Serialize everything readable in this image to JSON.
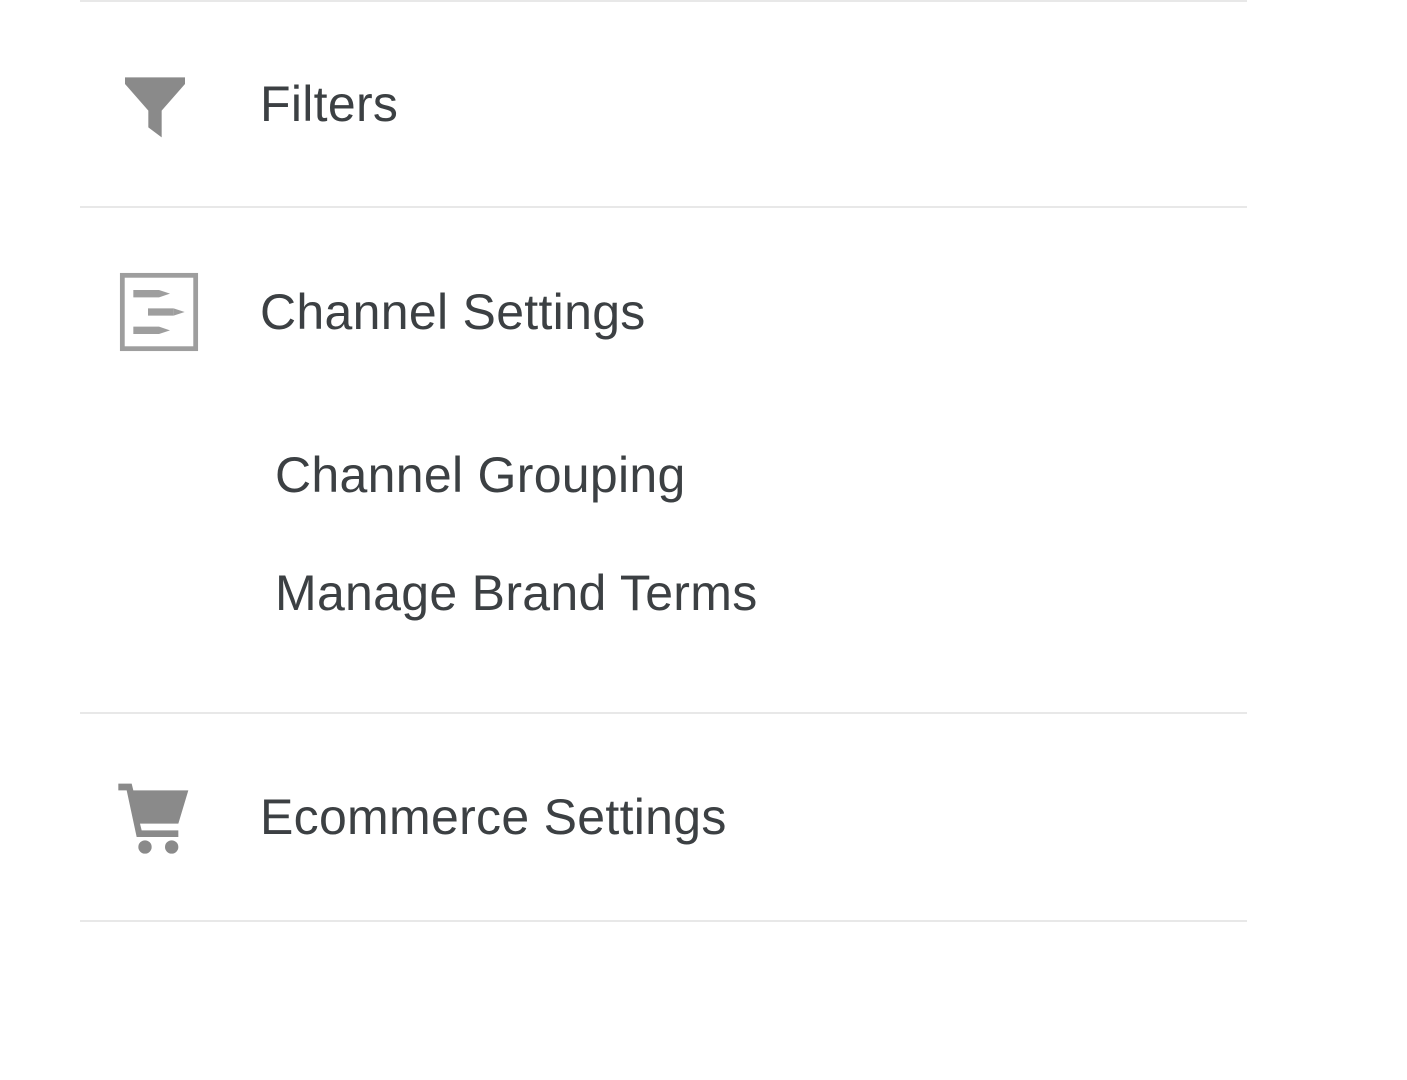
{
  "sidebar": {
    "items": [
      {
        "id": "filters",
        "label": "Filters",
        "icon": "funnel-icon"
      },
      {
        "id": "channel-settings",
        "label": "Channel Settings",
        "icon": "channel-icon",
        "expanded": true,
        "children": [
          {
            "id": "channel-grouping",
            "label": "Channel Grouping"
          },
          {
            "id": "manage-brand-terms",
            "label": "Manage Brand Terms"
          }
        ]
      },
      {
        "id": "ecommerce-settings",
        "label": "Ecommerce Settings",
        "icon": "cart-icon"
      }
    ]
  },
  "colors": {
    "icon": "#8a8a8a",
    "text": "#3c4043",
    "divider": "#e8e8e8"
  }
}
